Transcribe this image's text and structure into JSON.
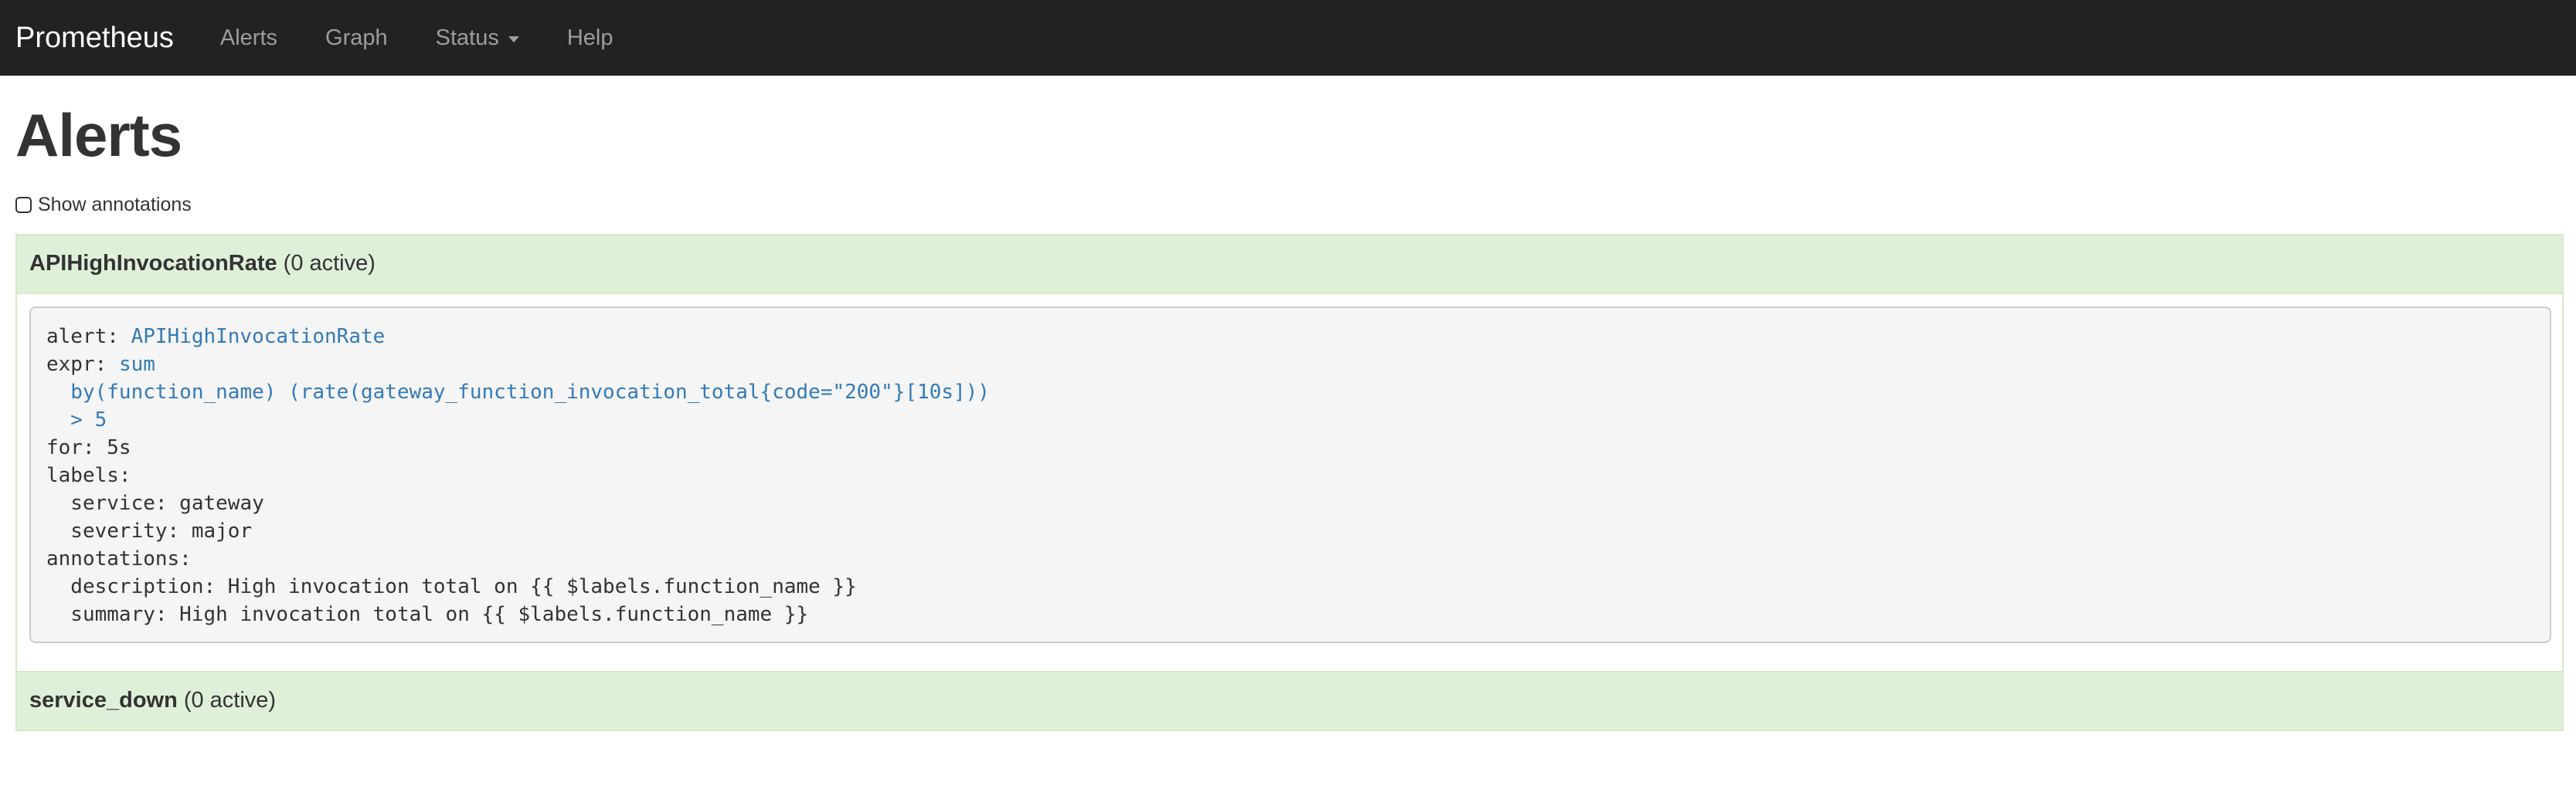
{
  "navbar": {
    "brand": "Prometheus",
    "items": [
      {
        "label": "Alerts"
      },
      {
        "label": "Graph"
      },
      {
        "label": "Status",
        "has_dropdown": true
      },
      {
        "label": "Help"
      }
    ]
  },
  "page": {
    "title": "Alerts",
    "show_annotations_label": "Show annotations",
    "show_annotations_checked": false
  },
  "groups": [
    {
      "name": "APIHighInvocationRate",
      "active_text": "(0 active)",
      "expanded": true,
      "rule": {
        "alert_key": "alert:",
        "alert_value": "APIHighInvocationRate",
        "expr_key": "expr:",
        "expr_lines": [
          "sum",
          "  by(function_name) (rate(gateway_function_invocation_total{code=\"200\"}[10s]))",
          "  > 5"
        ],
        "for_line": "for: 5s",
        "labels_key": "labels:",
        "labels_lines": [
          "  service: gateway",
          "  severity: major"
        ],
        "annotations_key": "annotations:",
        "annotations_lines": [
          "  description: High invocation total on {{ $labels.function_name }}",
          "  summary: High invocation total on {{ $labels.function_name }}"
        ]
      }
    },
    {
      "name": "service_down",
      "active_text": "(0 active)",
      "expanded": false
    }
  ],
  "colors": {
    "navbar_bg": "#222222",
    "nav_text": "#9d9d9d",
    "group_header_bg": "#dff0d8",
    "rule_value": "#337ab7"
  },
  "icons": {
    "status_dropdown": "caret-down-icon",
    "show_annotations": "checkbox-icon"
  }
}
